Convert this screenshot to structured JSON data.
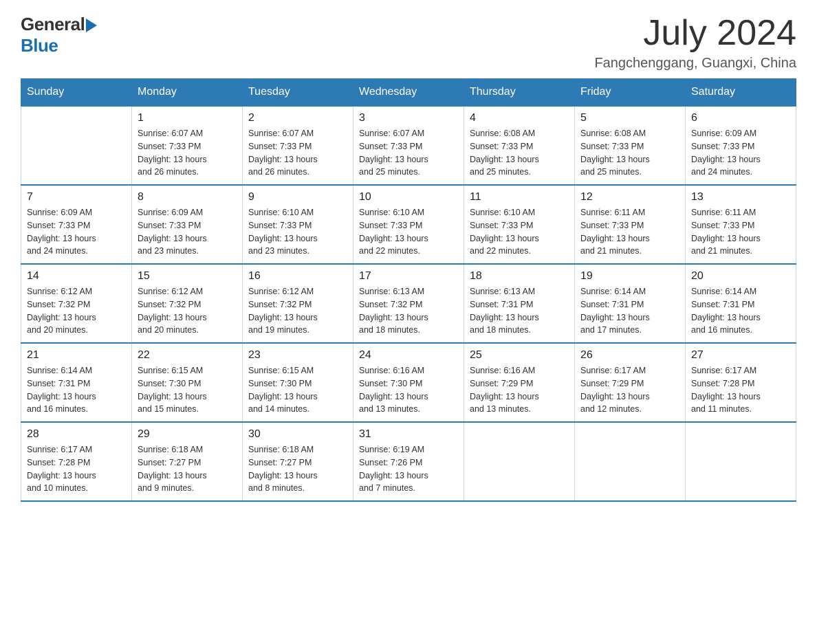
{
  "header": {
    "logo_general": "General",
    "logo_blue": "Blue",
    "month_title": "July 2024",
    "location": "Fangchenggang, Guangxi, China"
  },
  "weekdays": [
    "Sunday",
    "Monday",
    "Tuesday",
    "Wednesday",
    "Thursday",
    "Friday",
    "Saturday"
  ],
  "weeks": [
    [
      {
        "day": "",
        "info": ""
      },
      {
        "day": "1",
        "info": "Sunrise: 6:07 AM\nSunset: 7:33 PM\nDaylight: 13 hours\nand 26 minutes."
      },
      {
        "day": "2",
        "info": "Sunrise: 6:07 AM\nSunset: 7:33 PM\nDaylight: 13 hours\nand 26 minutes."
      },
      {
        "day": "3",
        "info": "Sunrise: 6:07 AM\nSunset: 7:33 PM\nDaylight: 13 hours\nand 25 minutes."
      },
      {
        "day": "4",
        "info": "Sunrise: 6:08 AM\nSunset: 7:33 PM\nDaylight: 13 hours\nand 25 minutes."
      },
      {
        "day": "5",
        "info": "Sunrise: 6:08 AM\nSunset: 7:33 PM\nDaylight: 13 hours\nand 25 minutes."
      },
      {
        "day": "6",
        "info": "Sunrise: 6:09 AM\nSunset: 7:33 PM\nDaylight: 13 hours\nand 24 minutes."
      }
    ],
    [
      {
        "day": "7",
        "info": "Sunrise: 6:09 AM\nSunset: 7:33 PM\nDaylight: 13 hours\nand 24 minutes."
      },
      {
        "day": "8",
        "info": "Sunrise: 6:09 AM\nSunset: 7:33 PM\nDaylight: 13 hours\nand 23 minutes."
      },
      {
        "day": "9",
        "info": "Sunrise: 6:10 AM\nSunset: 7:33 PM\nDaylight: 13 hours\nand 23 minutes."
      },
      {
        "day": "10",
        "info": "Sunrise: 6:10 AM\nSunset: 7:33 PM\nDaylight: 13 hours\nand 22 minutes."
      },
      {
        "day": "11",
        "info": "Sunrise: 6:10 AM\nSunset: 7:33 PM\nDaylight: 13 hours\nand 22 minutes."
      },
      {
        "day": "12",
        "info": "Sunrise: 6:11 AM\nSunset: 7:33 PM\nDaylight: 13 hours\nand 21 minutes."
      },
      {
        "day": "13",
        "info": "Sunrise: 6:11 AM\nSunset: 7:33 PM\nDaylight: 13 hours\nand 21 minutes."
      }
    ],
    [
      {
        "day": "14",
        "info": "Sunrise: 6:12 AM\nSunset: 7:32 PM\nDaylight: 13 hours\nand 20 minutes."
      },
      {
        "day": "15",
        "info": "Sunrise: 6:12 AM\nSunset: 7:32 PM\nDaylight: 13 hours\nand 20 minutes."
      },
      {
        "day": "16",
        "info": "Sunrise: 6:12 AM\nSunset: 7:32 PM\nDaylight: 13 hours\nand 19 minutes."
      },
      {
        "day": "17",
        "info": "Sunrise: 6:13 AM\nSunset: 7:32 PM\nDaylight: 13 hours\nand 18 minutes."
      },
      {
        "day": "18",
        "info": "Sunrise: 6:13 AM\nSunset: 7:31 PM\nDaylight: 13 hours\nand 18 minutes."
      },
      {
        "day": "19",
        "info": "Sunrise: 6:14 AM\nSunset: 7:31 PM\nDaylight: 13 hours\nand 17 minutes."
      },
      {
        "day": "20",
        "info": "Sunrise: 6:14 AM\nSunset: 7:31 PM\nDaylight: 13 hours\nand 16 minutes."
      }
    ],
    [
      {
        "day": "21",
        "info": "Sunrise: 6:14 AM\nSunset: 7:31 PM\nDaylight: 13 hours\nand 16 minutes."
      },
      {
        "day": "22",
        "info": "Sunrise: 6:15 AM\nSunset: 7:30 PM\nDaylight: 13 hours\nand 15 minutes."
      },
      {
        "day": "23",
        "info": "Sunrise: 6:15 AM\nSunset: 7:30 PM\nDaylight: 13 hours\nand 14 minutes."
      },
      {
        "day": "24",
        "info": "Sunrise: 6:16 AM\nSunset: 7:30 PM\nDaylight: 13 hours\nand 13 minutes."
      },
      {
        "day": "25",
        "info": "Sunrise: 6:16 AM\nSunset: 7:29 PM\nDaylight: 13 hours\nand 13 minutes."
      },
      {
        "day": "26",
        "info": "Sunrise: 6:17 AM\nSunset: 7:29 PM\nDaylight: 13 hours\nand 12 minutes."
      },
      {
        "day": "27",
        "info": "Sunrise: 6:17 AM\nSunset: 7:28 PM\nDaylight: 13 hours\nand 11 minutes."
      }
    ],
    [
      {
        "day": "28",
        "info": "Sunrise: 6:17 AM\nSunset: 7:28 PM\nDaylight: 13 hours\nand 10 minutes."
      },
      {
        "day": "29",
        "info": "Sunrise: 6:18 AM\nSunset: 7:27 PM\nDaylight: 13 hours\nand 9 minutes."
      },
      {
        "day": "30",
        "info": "Sunrise: 6:18 AM\nSunset: 7:27 PM\nDaylight: 13 hours\nand 8 minutes."
      },
      {
        "day": "31",
        "info": "Sunrise: 6:19 AM\nSunset: 7:26 PM\nDaylight: 13 hours\nand 7 minutes."
      },
      {
        "day": "",
        "info": ""
      },
      {
        "day": "",
        "info": ""
      },
      {
        "day": "",
        "info": ""
      }
    ]
  ]
}
